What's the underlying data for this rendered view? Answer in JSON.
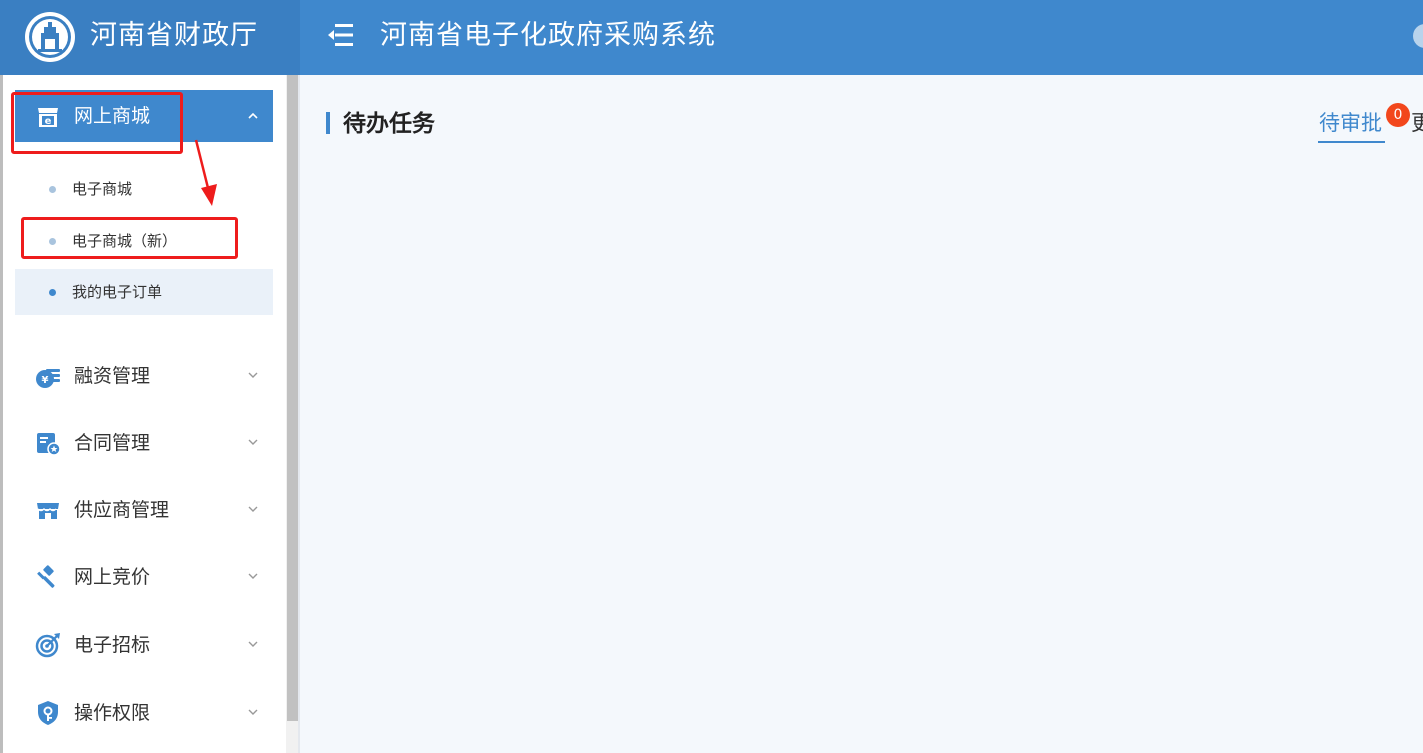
{
  "header": {
    "brand": "河南省财政厅",
    "system_title": "河南省电子化政府采购系统"
  },
  "sidebar": {
    "active_menu": {
      "label": "网上商城",
      "icon": "shop-icon",
      "submenu": [
        {
          "label": "电子商城",
          "selected": false
        },
        {
          "label": "电子商城（新）",
          "selected": false
        },
        {
          "label": "我的电子订单",
          "selected": true
        }
      ]
    },
    "menus": [
      {
        "label": "融资管理",
        "icon": "finance-icon"
      },
      {
        "label": "合同管理",
        "icon": "contract-icon"
      },
      {
        "label": "供应商管理",
        "icon": "supplier-icon"
      },
      {
        "label": "网上竞价",
        "icon": "gavel-icon"
      },
      {
        "label": "电子招标",
        "icon": "target-icon"
      },
      {
        "label": "操作权限",
        "icon": "shield-key-icon"
      }
    ]
  },
  "main": {
    "section_title": "待办任务",
    "tabs": {
      "pending_label": "待审批",
      "pending_count": "0",
      "more_label": "更"
    }
  },
  "colors": {
    "header": "#3f88cd",
    "brand_bg": "#3a7fc2",
    "accent": "#3f88cd",
    "badge": "#f2471c",
    "annotation": "#ee1c1c"
  }
}
